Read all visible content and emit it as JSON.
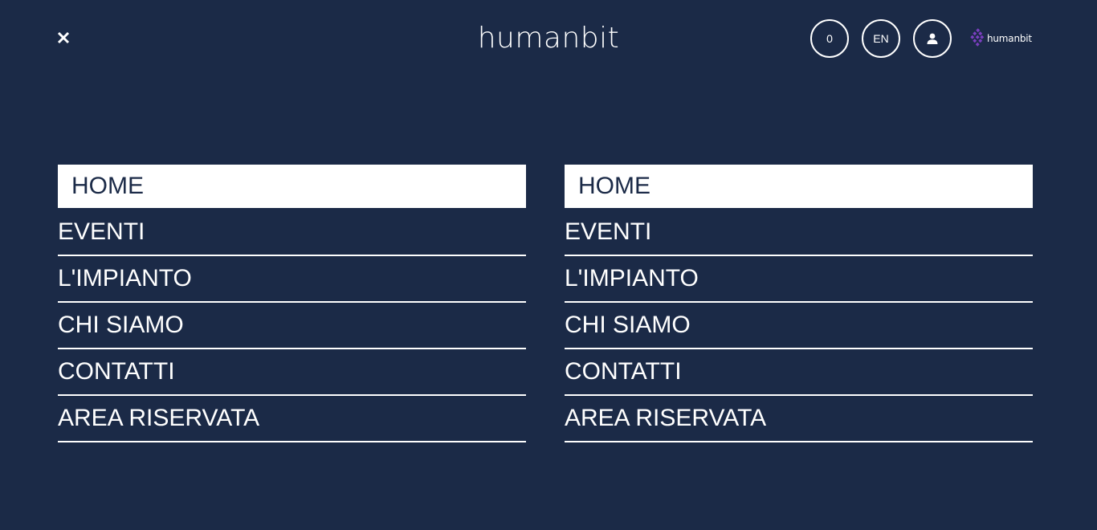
{
  "header": {
    "brand": "humanbit",
    "cart_count": "0",
    "language": "EN",
    "mini_logo_text": "humanbit",
    "icons": {
      "close": "close-icon",
      "user": "user-icon",
      "logo": "humanbit-logo-icon"
    },
    "colors": {
      "background": "#1b2a47",
      "text": "#ffffff",
      "logo_accent": "#7a3fbf"
    }
  },
  "menu_left": {
    "items": [
      {
        "label": "HOME",
        "active": true
      },
      {
        "label": "EVENTI"
      },
      {
        "label": "L'IMPIANTO"
      },
      {
        "label": "CHI SIAMO"
      },
      {
        "label": "CONTATTI"
      },
      {
        "label": "AREA RISERVATA"
      }
    ]
  },
  "menu_right": {
    "items": [
      {
        "label": "HOME",
        "active": true
      },
      {
        "label": "EVENTI"
      },
      {
        "label": "L'IMPIANTO"
      },
      {
        "label": "CHI SIAMO"
      },
      {
        "label": "CONTATTI"
      },
      {
        "label": "AREA RISERVATA"
      }
    ]
  }
}
